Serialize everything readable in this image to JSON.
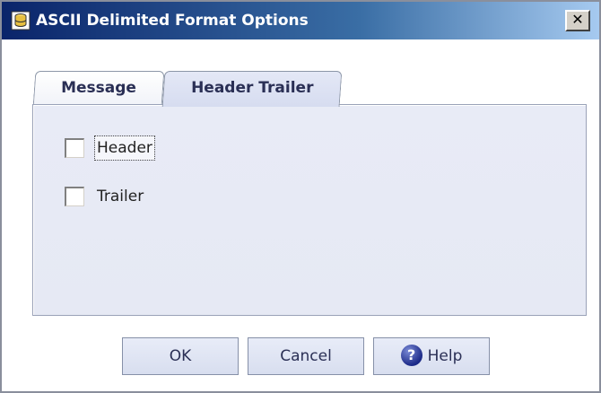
{
  "window": {
    "title": "ASCII Delimited Format Options",
    "close_label": "✕",
    "icon": "database-icon"
  },
  "tabs": [
    {
      "label": "Message",
      "active": false
    },
    {
      "label": "Header Trailer",
      "active": true
    }
  ],
  "panel": {
    "checkboxes": [
      {
        "label": "Header",
        "checked": false,
        "focused": true
      },
      {
        "label": "Trailer",
        "checked": false,
        "focused": false
      }
    ]
  },
  "buttons": {
    "ok_label": "OK",
    "cancel_label": "Cancel",
    "help_label": "Help",
    "help_icon": "help-icon"
  },
  "colors": {
    "titlebar_start": "#0a246a",
    "titlebar_end": "#a6caf0",
    "panel_bg": "#e8ebf6",
    "accent_text": "#2a2f55"
  }
}
